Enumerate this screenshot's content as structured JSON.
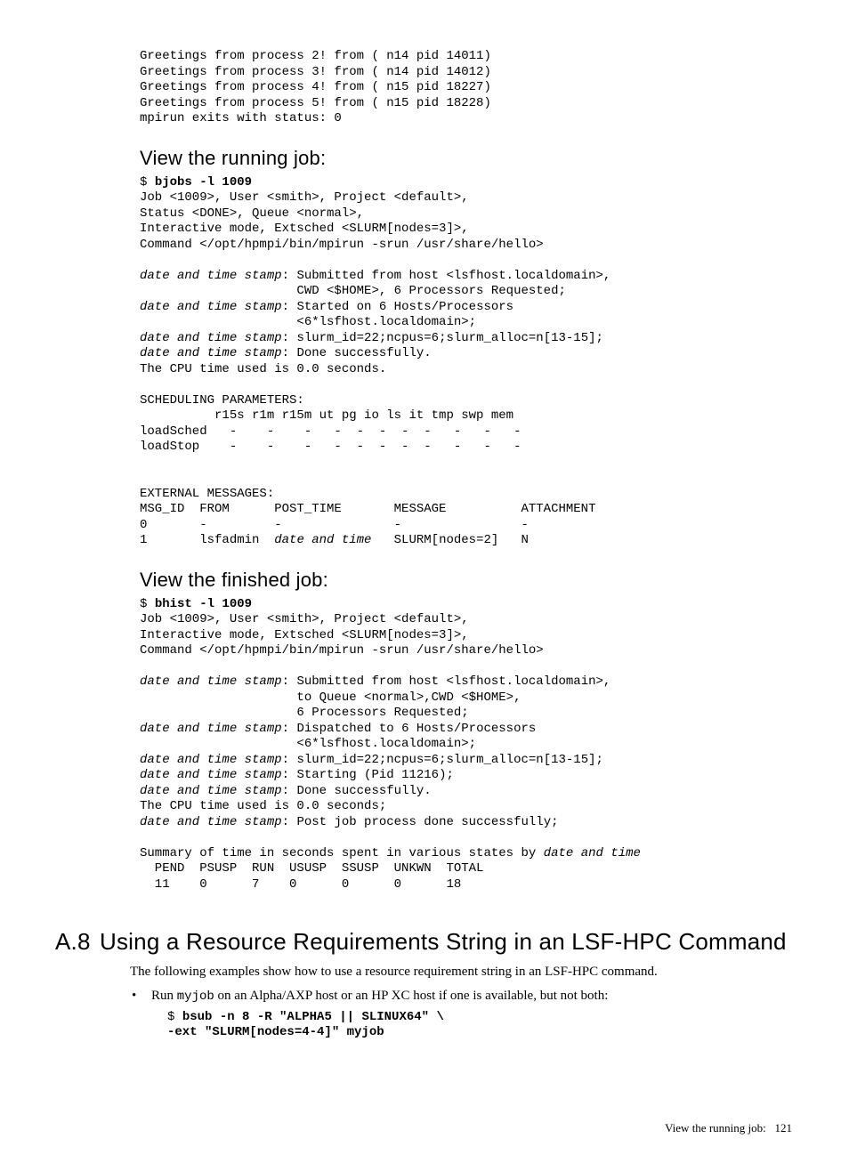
{
  "pre1": {
    "l1": "Greetings from process 2! from ( n14 pid 14011)",
    "l2": "Greetings from process 3! from ( n14 pid 14012)",
    "l3": "Greetings from process 4! from ( n15 pid 18227)",
    "l4": "Greetings from process 5! from ( n15 pid 18228)",
    "l5": "mpirun exits with status: 0"
  },
  "h1": "View the running job:",
  "bjobs": {
    "prompt": "$ ",
    "cmd": "bjobs -l 1009",
    "l1": "Job <1009>, User <smith>, Project <default>,",
    "l2": "Status <DONE>, Queue <normal>,",
    "l3": "Interactive mode, Extsched <SLURM[nodes=3]>,",
    "l4": "Command </opt/hpmpi/bin/mpirun -srun /usr/share/hello>",
    "dts": "date and time stamp",
    "a1": ": Submitted from host <lsfhost.localdomain>,",
    "a2": "                     CWD <$HOME>, 6 Processors Requested;",
    "b1": ": Started on 6 Hosts/Processors",
    "b2": "                     <6*lsfhost.localdomain>;",
    "c1": ": slurm_id=22;ncpus=6;slurm_alloc=n[13-15];",
    "d1": ": Done successfully.",
    "e1": "The CPU time used is 0.0 seconds.",
    "sp": "SCHEDULING PARAMETERS:",
    "hdr": "          r15s r1m r15m ut pg io ls it tmp swp mem",
    "ls": "loadSched   -    -    -   -  -  -  -  -   -   -   -",
    "lst": "loadStop    -    -    -   -  -  -  -  -   -   -   -",
    "em": "EXTERNAL MESSAGES:",
    "emh": "MSG_ID  FROM      POST_TIME       MESSAGE          ATTACHMENT",
    "em0": "0       -         -               -                -",
    "em1a": "1       lsfadmin  ",
    "em1b": "date and time",
    "em1c": "   SLURM[nodes=2]   N"
  },
  "h2": "View the finished job:",
  "bhist": {
    "prompt": "$ ",
    "cmd": "bhist -l 1009",
    "l1": "Job <1009>, User <smith>, Project <default>,",
    "l2": "Interactive mode, Extsched <SLURM[nodes=3]>,",
    "l3": "Command </opt/hpmpi/bin/mpirun -srun /usr/share/hello>",
    "dts": "date and time stamp",
    "a1": ": Submitted from host <lsfhost.localdomain>,",
    "a2": "                     to Queue <normal>,CWD <$HOME>,",
    "a3": "                     6 Processors Requested;",
    "b1": ": Dispatched to 6 Hosts/Processors",
    "b2": "                     <6*lsfhost.localdomain>;",
    "c1": ": slurm_id=22;ncpus=6;slurm_alloc=n[13-15];",
    "d1": ": Starting (Pid 11216);",
    "e1": ": Done successfully.",
    "f1": "The CPU time used is 0.0 seconds;",
    "g1": ": Post job process done successfully;",
    "sumA": "Summary of time in seconds spent in various states by ",
    "sumB": "date and time",
    "sh": "  PEND  PSUSP  RUN  USUSP  SSUSP  UNKWN  TOTAL",
    "sv": "  11    0      7    0      0      0      18"
  },
  "sec": {
    "num": "A.8",
    "title": "Using a Resource Requirements String in an LSF-HPC Command",
    "para": "The following examples show how to use a resource requirement string in an LSF-HPC command.",
    "bulletA": "Run ",
    "bulletCode": "myjob",
    "bulletB": " on an Alpha/AXP host or an HP XC host if one is available, but not both:",
    "cprompt": "$ ",
    "cline1": "bsub -n 8 -R \"ALPHA5 || SLINUX64\" \\",
    "cline2": "-ext \"SLURM[nodes=4-4]\" myjob"
  },
  "footer": {
    "label": "View the running job:",
    "page": "121"
  }
}
